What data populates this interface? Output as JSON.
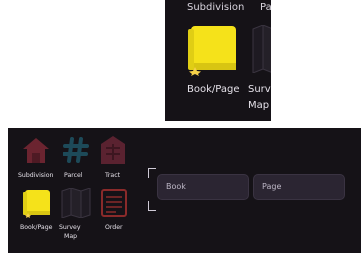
{
  "zoom": {
    "top_labels": [
      "Subdivision",
      "Pa"
    ],
    "book_label": "Book/Page",
    "survey_label_line1": "Surv",
    "survey_label_line2": "Map"
  },
  "tools": {
    "subdivision": "Subdivision",
    "parcel": "Parcel",
    "tract": "Tract",
    "book_page": "Book/Page",
    "survey_map_line1": "Survey",
    "survey_map_line2": "Map",
    "order": "Order"
  },
  "fields": {
    "book_placeholder": "Book",
    "page_placeholder": "Page"
  },
  "colors": {
    "background": "#151217",
    "field_bg": "#2b2532",
    "accent_yellow": "#f5e21a",
    "subdivision_red": "#6b2430",
    "parcel_teal": "#1d4a59",
    "tract_red": "#5a2230",
    "order_red": "#8a2a2a"
  }
}
